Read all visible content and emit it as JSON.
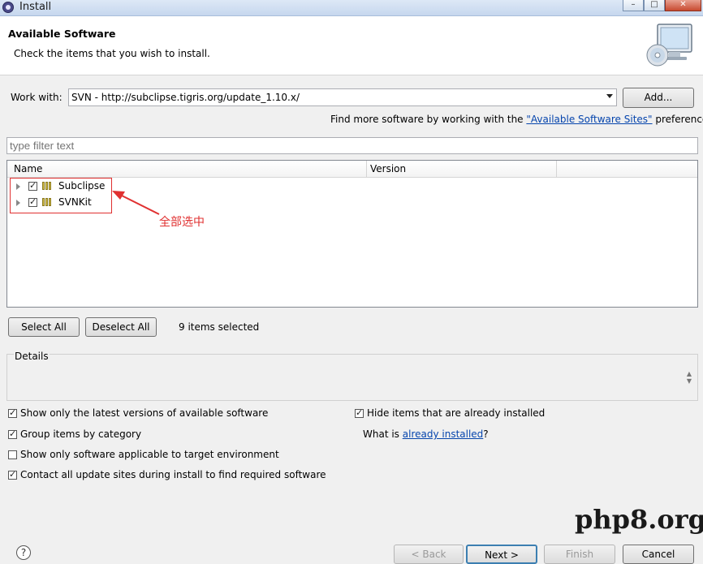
{
  "window": {
    "title": "Install",
    "controls": [
      "minimize-icon",
      "maximize-icon",
      "close-icon"
    ]
  },
  "header": {
    "title": "Available Software",
    "subtitle": "Check the items that you wish to install.",
    "icon": "monitor-cd-icon"
  },
  "work_with": {
    "label": "Work with:",
    "value": "SVN - http://subclipse.tigris.org/update_1.10.x/",
    "add_label": "Add..."
  },
  "find_more": {
    "prefix": "Find more software by working with the ",
    "link": "\"Available Software Sites\"",
    "suffix": " preferences."
  },
  "filter": {
    "placeholder": "type filter text"
  },
  "tree": {
    "columns": [
      "Name",
      "Version"
    ],
    "items": [
      {
        "label": "Subclipse",
        "checked": true,
        "expanded": false
      },
      {
        "label": "SVNKit",
        "checked": true,
        "expanded": false
      }
    ]
  },
  "annotation": {
    "text": "全部选中",
    "color": "#e03030"
  },
  "selection": {
    "select_all": "Select All",
    "deselect_all": "Deselect All",
    "status": "9 items selected"
  },
  "details": {
    "label": "Details"
  },
  "options": {
    "latest_versions": {
      "label": "Show only the latest versions of available software",
      "checked": true
    },
    "group_by_category": {
      "label": "Group items by category",
      "checked": true
    },
    "target_env": {
      "label": "Show only software applicable to target environment",
      "checked": false
    },
    "contact_sites": {
      "label": "Contact all update sites during install to find required software",
      "checked": true
    },
    "hide_installed": {
      "label": "Hide items that are already installed",
      "checked": true
    },
    "what_is_prefix": "What is ",
    "what_is_link": "already installed",
    "what_is_suffix": "?"
  },
  "footer": {
    "help": "?",
    "back": "< Back",
    "next": "Next >",
    "finish": "Finish",
    "cancel": "Cancel"
  },
  "watermark": "php8.org",
  "colors": {
    "link": "#0645ad",
    "annotation": "#e03030",
    "focus_border": "#3c7fb1"
  }
}
